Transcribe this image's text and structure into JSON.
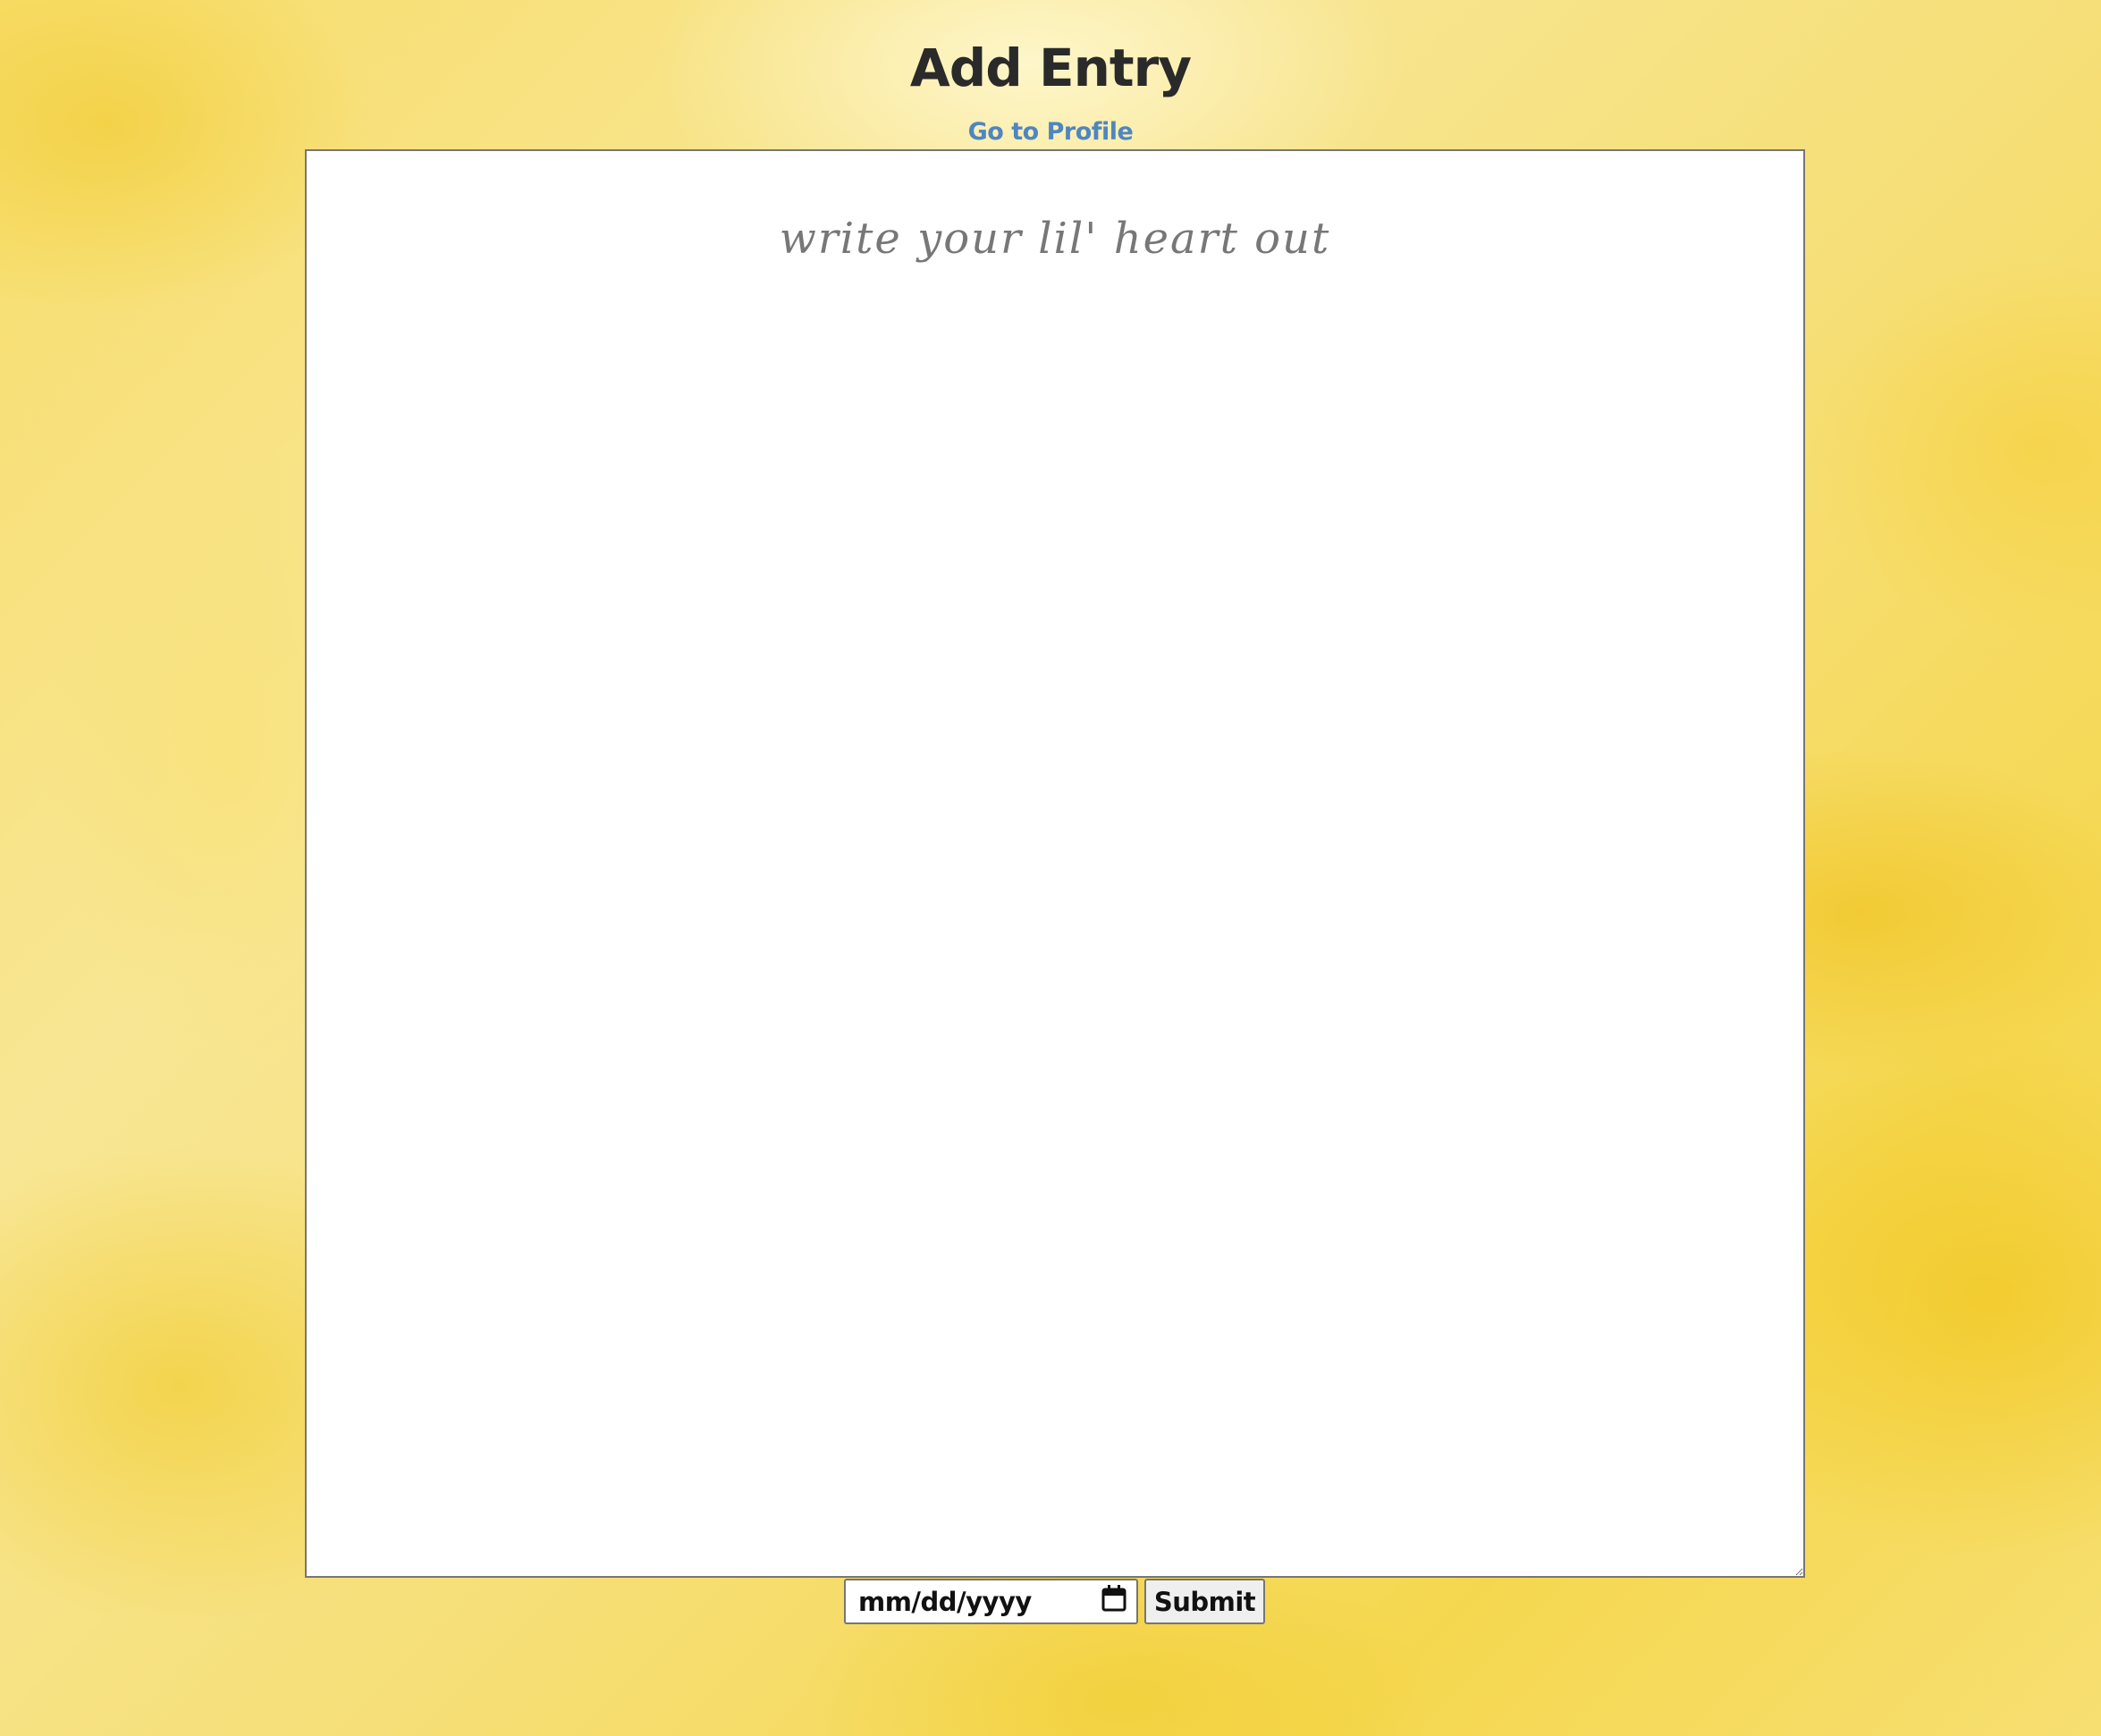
{
  "header": {
    "title": "Add Entry",
    "profile_link": "Go to Profile"
  },
  "entry": {
    "value": "",
    "placeholder": "write your lil' heart out"
  },
  "date_field": {
    "placeholder": "mm/dd/yyyy",
    "icon": "calendar-icon"
  },
  "submit": {
    "label": "Submit"
  },
  "colors": {
    "link": "#4f86c1",
    "title": "#2a2a2a",
    "background_accent": "#f5d74f"
  }
}
